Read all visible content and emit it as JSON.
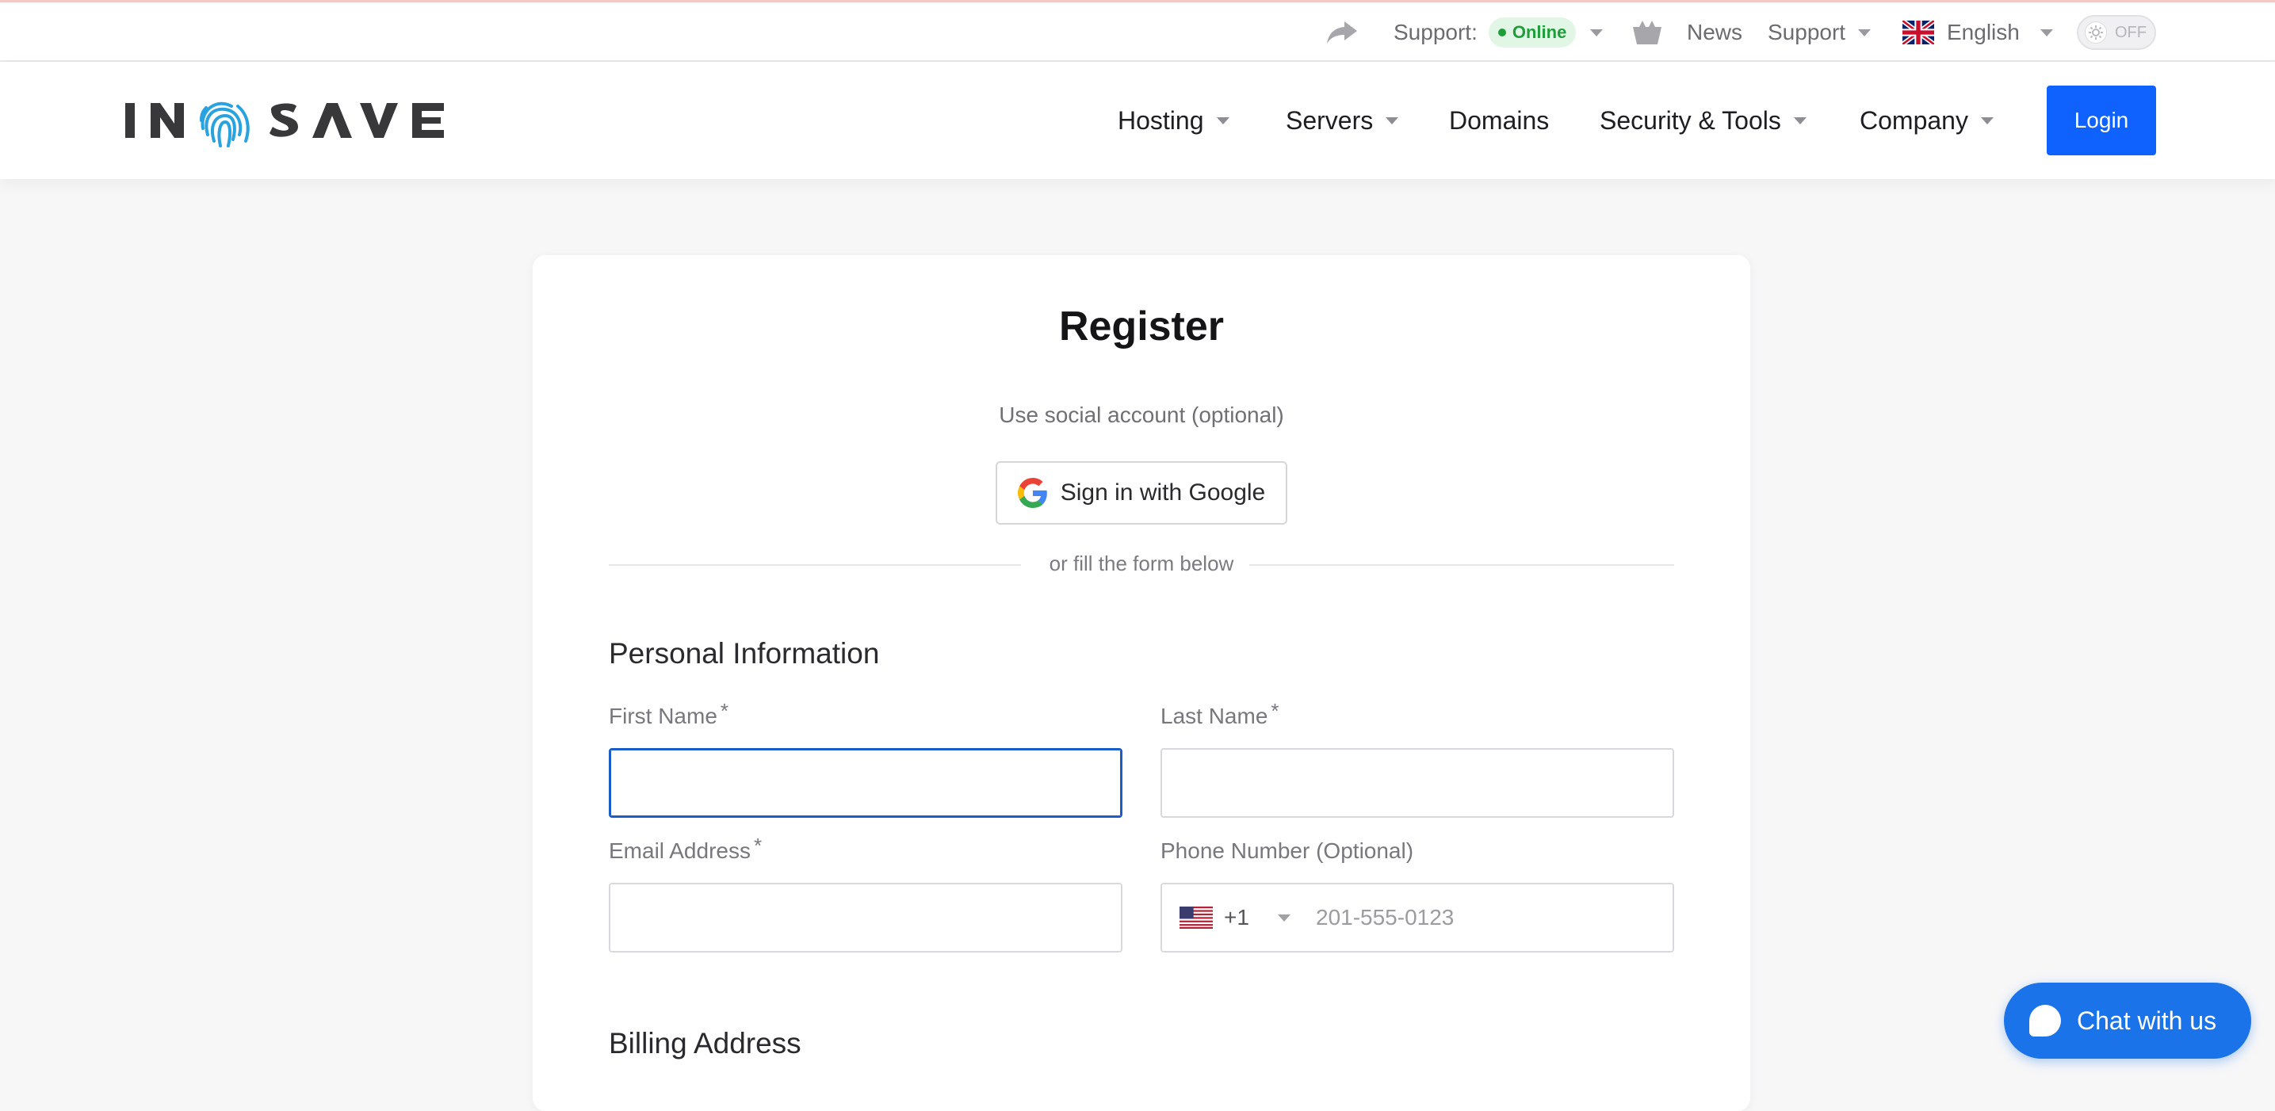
{
  "topbar": {
    "support_label": "Support:",
    "status": "Online",
    "news": "News",
    "support_menu": "Support",
    "language": "English",
    "theme_toggle": "OFF"
  },
  "header": {
    "logo_text": "IN SAVE",
    "nav": [
      {
        "label": "Hosting"
      },
      {
        "label": "Servers"
      },
      {
        "label": "Domains"
      },
      {
        "label": "Security & Tools"
      },
      {
        "label": "Company"
      }
    ],
    "login": "Login"
  },
  "register": {
    "title": "Register",
    "social_note": "Use social account (optional)",
    "google_button": "Sign in with Google",
    "divider": "or fill the form below",
    "personal_heading": "Personal Information",
    "first_name_label": "First Name",
    "last_name_label": "Last Name",
    "email_label": "Email Address",
    "phone_label": "Phone Number (Optional)",
    "required_mark": "*",
    "phone_country_code": "+1",
    "phone_placeholder": "201-555-0123",
    "first_name_value": "",
    "last_name_value": "",
    "email_value": "",
    "billing_heading": "Billing Address"
  },
  "chat": {
    "label": "Chat with us"
  },
  "colors": {
    "accent": "#0f62fe",
    "chat": "#1a73e8",
    "online": "#1f9d3a",
    "focus": "#1a5dc9"
  }
}
